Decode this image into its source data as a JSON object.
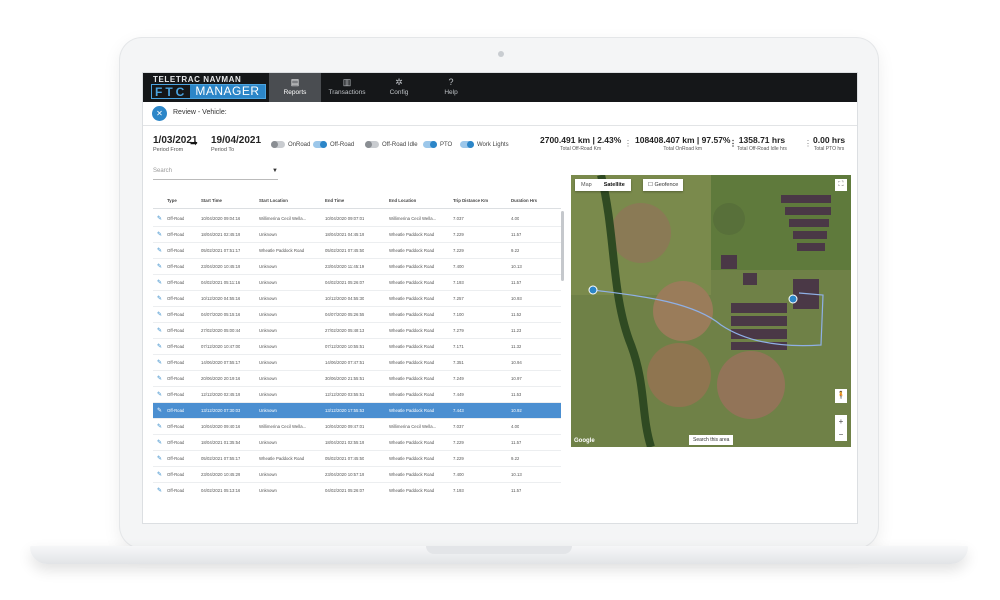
{
  "brand": {
    "top": "TELETRAC NAVMAN",
    "ftc": "FTC",
    "manager": "MANAGER"
  },
  "nav": [
    {
      "label": "Reports",
      "icon": "document-icon",
      "active": true
    },
    {
      "label": "Transactions",
      "icon": "receipt-icon",
      "active": false
    },
    {
      "label": "Config",
      "icon": "gear-icon",
      "active": false
    },
    {
      "label": "Help",
      "icon": "help-icon",
      "active": false
    }
  ],
  "subheader": {
    "label": "Review - Vehicle:"
  },
  "period": {
    "from_value": "1/03/2021",
    "from_label": "Period From",
    "to_value": "19/04/2021",
    "to_label": "Period To"
  },
  "toggles": [
    {
      "label": "OnRoad",
      "on": false
    },
    {
      "label": "Off-Road",
      "on": true
    },
    {
      "label": "Off-Road Idle",
      "on": false
    },
    {
      "label": "PTO",
      "on": true
    },
    {
      "label": "Work Lights",
      "on": true
    }
  ],
  "stats": [
    {
      "value": "2700.491 km | 2.43%",
      "label": "Total Off-Road Km"
    },
    {
      "value": "108408.407 km | 97.57%",
      "label": "Total OnRoad km"
    },
    {
      "value": "1358.71 hrs",
      "label": "Total Off-Road Idle hrs"
    },
    {
      "value": "0.00 hrs",
      "label": "Total PTO hrs"
    }
  ],
  "search": {
    "placeholder": "Search"
  },
  "table": {
    "headers": [
      "Type",
      "Start Time",
      "Start Location",
      "End Time",
      "End Location",
      "Trip Distance Km",
      "Duration Hrs"
    ],
    "rows": [
      [
        "Off-Road",
        "10/04/2020 09:04:16",
        "Willimerina Cecil Wella...",
        "10/04/2020 09:07:01",
        "Willimerina Cecil Wella...",
        "7.037",
        "4.00"
      ],
      [
        "Off-Road",
        "18/04/2021 02:45:19",
        "Unknown",
        "18/04/2021 04:45:19",
        "Wheatle Paddock Road",
        "7.229",
        "11.57"
      ],
      [
        "Off-Road",
        "05/02/2021 07:51:17",
        "Wheatle Paddock Road",
        "05/02/2021 07:45:50",
        "Wheatle Paddock Road",
        "7.229",
        "9.22"
      ],
      [
        "Off-Road",
        "23/04/2020 10:45:19",
        "Unknown",
        "23/04/2020 11:45:19",
        "Wheatle Paddock Road",
        "7.400",
        "10.13"
      ],
      [
        "Off-Road",
        "04/02/2021 05:11:16",
        "Unknown",
        "04/02/2021 05:26:07",
        "Wheatle Paddock Road",
        "7.193",
        "11.57"
      ],
      [
        "Off-Road",
        "10/12/2020 04:55:16",
        "Unknown",
        "10/12/2020 04:55:30",
        "Wheatle Paddock Road",
        "7.257",
        "10.93"
      ],
      [
        "Off-Road",
        "04/07/2020 05:15:16",
        "Unknown",
        "04/07/2020 05:26:55",
        "Wheatle Paddock Road",
        "7.100",
        "11.52"
      ],
      [
        "Off-Road",
        "27/02/2020 05:00:44",
        "Unknown",
        "27/02/2020 05:48:13",
        "Wheatle Paddock Road",
        "7.279",
        "11.23"
      ],
      [
        "Off-Road",
        "07/12/2020 10:47:00",
        "Unknown",
        "07/12/2020 10:55:51",
        "Wheatle Paddock Road",
        "7.171",
        "11.32"
      ],
      [
        "Off-Road",
        "14/06/2020 07:55:17",
        "Unknown",
        "14/06/2020 07:47:51",
        "Wheatle Paddock Road",
        "7.351",
        "10.94"
      ],
      [
        "Off-Road",
        "20/06/2020 20:19:16",
        "Unknown",
        "30/06/2020 21:55:51",
        "Wheatle Paddock Road",
        "7.249",
        "10.97"
      ],
      [
        "Off-Road",
        "12/12/2020 02:45:19",
        "Unknown",
        "12/12/2020 03:55:51",
        "Wheatle Paddock Road",
        "7.449",
        "11.53"
      ],
      [
        "Off-Road",
        "13/12/2020 07:30:03",
        "Unknown",
        "13/12/2020 17:55:53",
        "Wheatle Paddock Road",
        "7.443",
        "10.92"
      ],
      [
        "Off-Road",
        "10/04/2020 09:40:16",
        "Willimerina Cecil Wella...",
        "10/04/2020 09:47:01",
        "Willimerina Cecil Wella...",
        "7.037",
        "4.00"
      ],
      [
        "Off-Road",
        "18/04/2021 01:35:54",
        "Unknown",
        "18/04/2021 02:55:19",
        "Wheatle Paddock Road",
        "7.229",
        "11.57"
      ],
      [
        "Off-Road",
        "05/02/2021 07:55:17",
        "Wheatle Paddock Road",
        "05/02/2021 07:45:50",
        "Wheatle Paddock Road",
        "7.229",
        "9.22"
      ],
      [
        "Off-Road",
        "23/04/2020 10:45:29",
        "Unknown",
        "23/04/2020 10:57:19",
        "Wheatle Paddock Road",
        "7.400",
        "10.13"
      ],
      [
        "Off-Road",
        "04/02/2021 05:13:16",
        "Unknown",
        "04/02/2021 05:26:07",
        "Wheatle Paddock Road",
        "7.193",
        "11.57"
      ]
    ],
    "selected_index": 12
  },
  "map": {
    "tab_map": "Map",
    "tab_satellite": "Satellite",
    "geofence": "Geofence",
    "search_area": "Search this area",
    "google": "Google",
    "zoom_in": "+",
    "zoom_out": "−",
    "fullscreen": "⛶",
    "pegman": "🧍"
  },
  "colors": {
    "accent": "#2c86c8",
    "nav_bg": "#151719",
    "selected_row": "#4b8fd1"
  }
}
